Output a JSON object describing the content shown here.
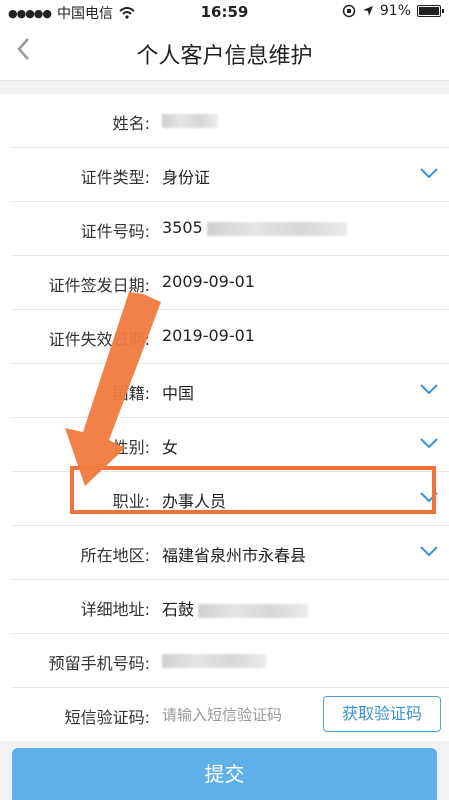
{
  "status_bar": {
    "carrier": "中国电信",
    "time": "16:59",
    "battery": "91%",
    "battery_level": 0.91
  },
  "header": {
    "title": "个人客户信息维护",
    "back_icon": "chevron-left-icon"
  },
  "form": {
    "rows": [
      {
        "label": "姓名:",
        "value": "",
        "redacted": true,
        "dropdown": false
      },
      {
        "label": "证件类型:",
        "value": "身份证",
        "dropdown": true
      },
      {
        "label": "证件号码:",
        "value": "3505",
        "redacted": true,
        "dropdown": false
      },
      {
        "label": "证件签发日期:",
        "value": "2009-09-01",
        "dropdown": false
      },
      {
        "label": "证件失效日期:",
        "value": "2019-09-01",
        "dropdown": false
      },
      {
        "label": "国籍:",
        "value": "中国",
        "dropdown": true
      },
      {
        "label": "性别:",
        "value": "女",
        "dropdown": true
      },
      {
        "label": "职业:",
        "value": "办事人员",
        "dropdown": true,
        "highlighted": true
      },
      {
        "label": "所在地区:",
        "value": "福建省泉州市永春县",
        "dropdown": true
      },
      {
        "label": "详细地址:",
        "value": "石鼓",
        "redacted": true,
        "dropdown": false
      },
      {
        "label": "预留手机号码:",
        "value": "",
        "redacted": true,
        "dropdown": false
      },
      {
        "label": "短信验证码:",
        "placeholder": "请输入短信验证码",
        "button": "获取验证码"
      }
    ]
  },
  "submit_label": "提交",
  "colors": {
    "accent": "#3a93d6",
    "submit_bg": "#5fb0ea",
    "highlight": "#f0713a",
    "arrow": "#f07a3e"
  }
}
